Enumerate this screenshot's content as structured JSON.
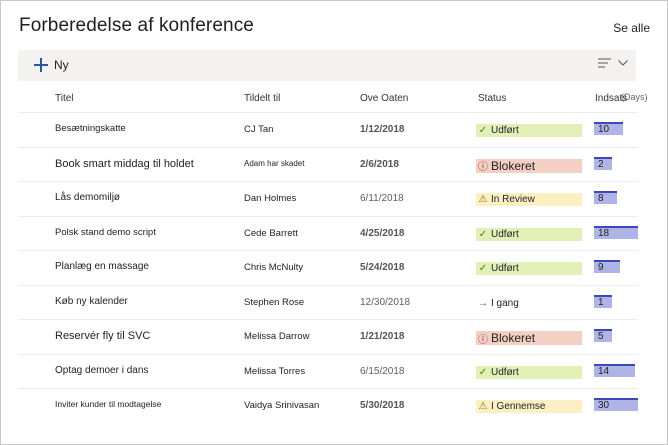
{
  "header": {
    "title": "Forberedelse af konference",
    "see_all": "Se alle"
  },
  "toolbar": {
    "new_label": "Ny",
    "view_icon": "lines-icon",
    "chevron_icon": "chevron-down-icon"
  },
  "columns": {
    "title": "Titel",
    "assigned": "Tildelt til",
    "due": "Ove Oaten",
    "status": "Status",
    "effort": "Indsats",
    "effort_unit": "(Days)"
  },
  "colors": {
    "done": "#e2f0b8",
    "blocked": "#f4cfc4",
    "review": "#fbefc3",
    "progress": "#ffffff",
    "effort_bar": "#aeb4e6",
    "effort_line": "#3b48b8"
  },
  "rows": [
    {
      "title": "Besætningskatte",
      "assigned": "CJ Tan",
      "due": "1/12/2018",
      "due_bold": true,
      "status": "Udført",
      "status_kind": "done",
      "status_icon": "check-icon",
      "effort": "10",
      "effort_fraction": 0.67
    },
    {
      "title": "Book smart middag til holdet",
      "assigned": "Adam har skadet",
      "due": "2/6/2018",
      "due_bold": true,
      "status": "Blokeret",
      "status_kind": "blocked",
      "status_icon": "blocked-circle-icon",
      "effort": "2",
      "effort_fraction": 0.13
    },
    {
      "title": "Lås demomiljø",
      "assigned": "Dan Holmes",
      "due": "6/11/2018",
      "due_bold": false,
      "status": "In Review",
      "status_kind": "review",
      "status_icon": "warning-icon",
      "effort": "8",
      "effort_fraction": 0.53
    },
    {
      "title": "Polsk stand demo script",
      "assigned": "Cede Barrett",
      "due": "4/25/2018",
      "due_bold": true,
      "status": "Udført",
      "status_kind": "done",
      "status_icon": "check-icon",
      "effort": "18",
      "effort_fraction": 1.0
    },
    {
      "title": "Planlæg en massage",
      "assigned": "Chris McNulty",
      "due": "5/24/2018",
      "due_bold": true,
      "status": "Udført",
      "status_kind": "done",
      "status_icon": "check-icon",
      "effort": "9",
      "effort_fraction": 0.6
    },
    {
      "title": "Køb ny kalender",
      "assigned": "Stephen Rose",
      "due": "12/30/2018",
      "due_bold": false,
      "status": "I gang",
      "status_kind": "progress",
      "status_icon": "arrow-right-icon",
      "effort": "1",
      "effort_fraction": 0.07
    },
    {
      "title": "Reservér fly til SVC",
      "assigned": "Melissa Darrow",
      "due": "1/21/2018",
      "due_bold": true,
      "status": "Blokeret",
      "status_kind": "blocked",
      "status_icon": "blocked-circle-icon",
      "effort": "5",
      "effort_fraction": 0.33
    },
    {
      "title": "Optag demoer i dans",
      "assigned": "Melissa Torres",
      "due": "6/15/2018",
      "due_bold": false,
      "status": "Udført",
      "status_kind": "done",
      "status_icon": "check-icon",
      "effort": "14",
      "effort_fraction": 0.93
    },
    {
      "title": "Inviter kunder til modtagelse",
      "assigned": "Vaidya Srinivasan",
      "due": "5/30/2018",
      "due_bold": true,
      "status": "I Gennemse",
      "status_kind": "review",
      "status_icon": "warning-icon",
      "effort": "30",
      "effort_fraction": 1.0
    }
  ]
}
